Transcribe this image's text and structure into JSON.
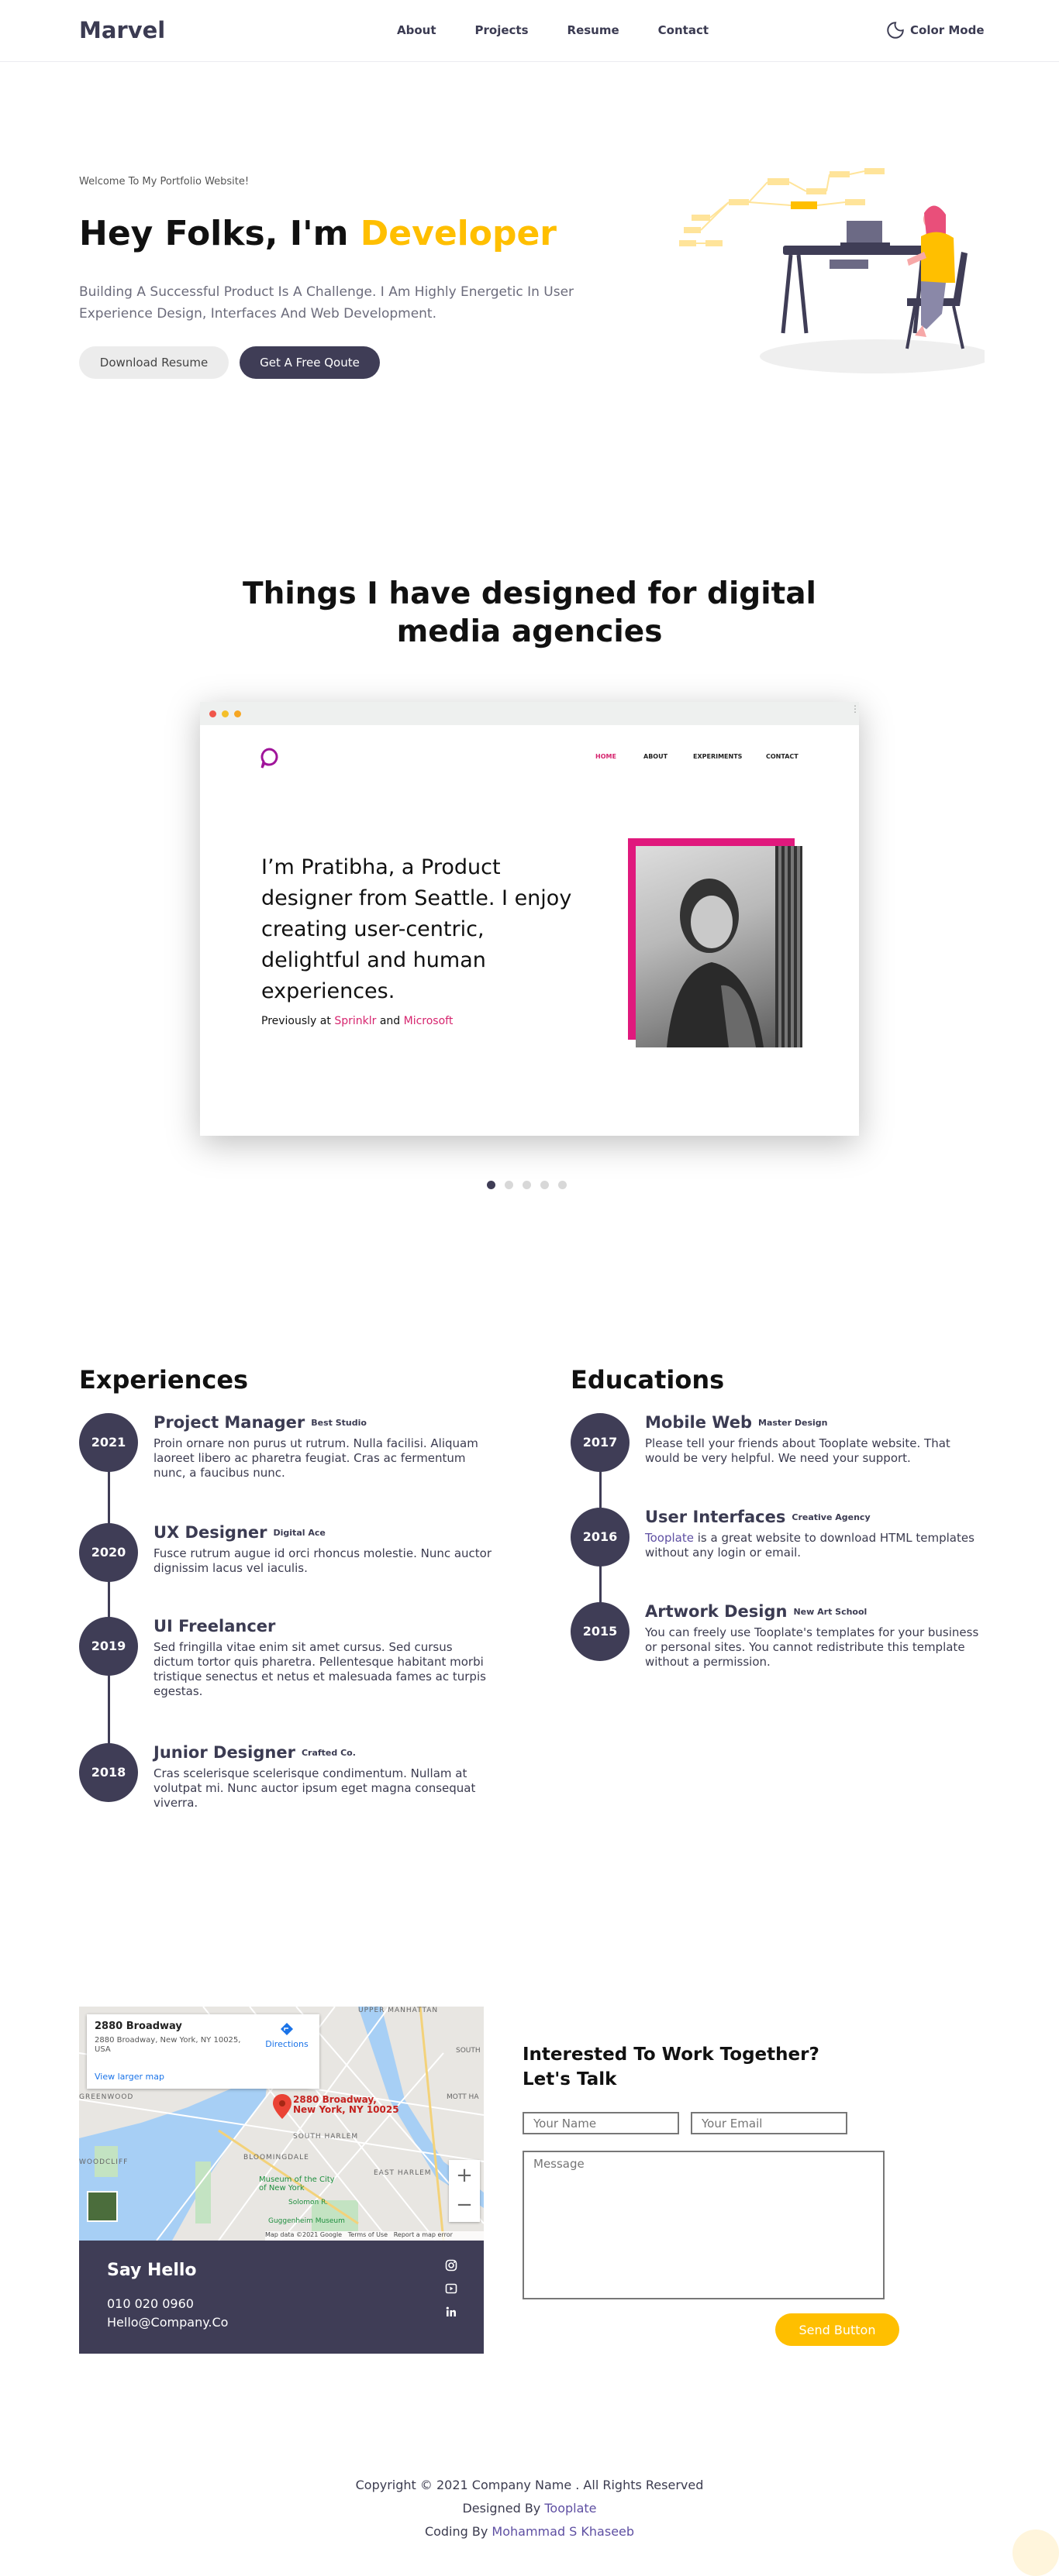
{
  "nav": {
    "brand": "Marvel",
    "links": [
      "About",
      "Projects",
      "Resume",
      "Contact"
    ],
    "color_mode": "Color Mode",
    "icon": "moon-icon"
  },
  "hero": {
    "welcome": "Welcome To My Portfolio Website!",
    "title_prefix": "Hey Folks, I'm",
    "title_highlight": "Developer",
    "description": "Building A Successful Product Is A Challenge. I Am Highly Energetic In User Experience Design, Interfaces And Web Development.",
    "btn_download": "Download Resume",
    "btn_quote": "Get A Free Qoute",
    "accent": "#ffbf00",
    "dark": "#3f3d56"
  },
  "portfolio": {
    "title": "Things I have designed for digital media agencies",
    "mini_nav": [
      "HOME",
      "ABOUT",
      "EXPERIMENTS",
      "CONTACT"
    ],
    "headline": "I’m Pratibha, a Product designer from Seattle. I enjoy creating user-centric, delightful and human experiences.",
    "previously": "Previously at",
    "company1": "Sprinklr",
    "and": "and",
    "company2": "Microsoft",
    "active_slide": 1,
    "slide_count": 5
  },
  "experiences": {
    "title": "Experiences",
    "items": [
      {
        "year": "2021",
        "role": "Project Manager",
        "org": "Best Studio",
        "desc": "Proin ornare non purus ut rutrum. Nulla facilisi. Aliquam laoreet libero ac pharetra feugiat. Cras ac fermentum nunc, a faucibus nunc."
      },
      {
        "year": "2020",
        "role": "UX Designer",
        "org": "Digital Ace",
        "desc": "Fusce rutrum augue id orci rhoncus molestie. Nunc auctor dignissim lacus vel iaculis."
      },
      {
        "year": "2019",
        "role": "UI Freelancer",
        "org": "",
        "desc": "Sed fringilla vitae enim sit amet cursus. Sed cursus dictum tortor quis pharetra. Pellentesque habitant morbi tristique senectus et netus et malesuada fames ac turpis egestas."
      },
      {
        "year": "2018",
        "role": "Junior Designer",
        "org": "Crafted Co.",
        "desc": "Cras scelerisque scelerisque condimentum. Nullam at volutpat mi. Nunc auctor ipsum eget magna consequat viverra."
      }
    ]
  },
  "educations": {
    "title": "Educations",
    "items": [
      {
        "year": "2017",
        "role": "Mobile Web",
        "org": "Master Design",
        "desc": "Please tell your friends about Tooplate website. That would be very helpful. We need your support."
      },
      {
        "year": "2016",
        "role": "User Interfaces",
        "org": "Creative Agency",
        "desc_link": "Tooplate",
        "desc": " is a great website to download HTML templates without any login or email."
      },
      {
        "year": "2015",
        "role": "Artwork Design",
        "org": "New Art School",
        "desc": "You can freely use Tooplate's templates for your business or personal sites. You cannot redistribute this template without a permission."
      }
    ]
  },
  "map": {
    "place": "2880 Broadway",
    "address": "2880 Broadway, New York, NY 10025, USA",
    "directions": "Directions",
    "larger_map": "View larger map",
    "pin_label": "2880 Broadway, New York, NY 10025",
    "labels": [
      "UPPER MANHATTAN",
      "SOUTH",
      "MOTT HA",
      "SOUTH HARLEM",
      "BLOOMINGDALE",
      "EAST HARLEM",
      "GREENWOOD",
      "WOODCLIFF",
      "Museum of the City of New York",
      "Guggenheim Museum",
      "Solomon R."
    ],
    "footer_text": [
      "Map data ©2021 Google",
      "Terms of Use",
      "Report a map error"
    ]
  },
  "say_hello": {
    "title": "Say Hello",
    "phone": "010 020 0960",
    "email": "Hello@Company.Co",
    "icons": [
      "instagram-icon",
      "youtube-icon",
      "linkedin-icon"
    ]
  },
  "contact": {
    "title": "Interested To Work Together? Let's Talk",
    "name_placeholder": "Your Name",
    "email_placeholder": "Your Email",
    "message_placeholder": "Message",
    "send": "Send Button"
  },
  "footer": {
    "copyright": "Copyright © 2021 Company Name . All Rights Reserved",
    "designed_prefix": "Designed By",
    "designed_link": "Tooplate",
    "coding_prefix": "Coding By",
    "coding_link": "Mohammad S Khaseeb"
  }
}
